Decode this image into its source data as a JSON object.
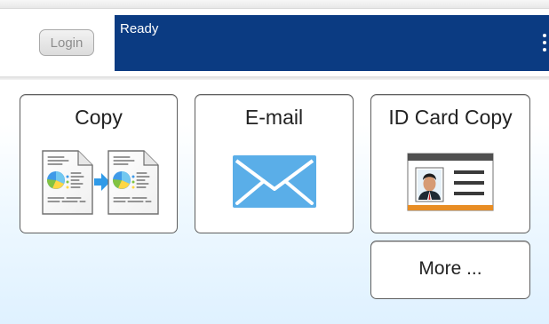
{
  "header": {
    "login_label": "Login",
    "status_text": "Ready",
    "menu_icon": "vertical-ellipsis-icon"
  },
  "tiles": [
    {
      "label": "Copy",
      "icon": "copy-document-icon"
    },
    {
      "label": "E-mail",
      "icon": "envelope-icon"
    },
    {
      "label": "ID Card Copy",
      "icon": "id-card-icon"
    },
    {
      "label": "More ...",
      "icon": ""
    }
  ],
  "colors": {
    "status_bar": "#0b3b82",
    "accent_blue": "#2f9ae8",
    "card_orange": "#e88d24"
  }
}
